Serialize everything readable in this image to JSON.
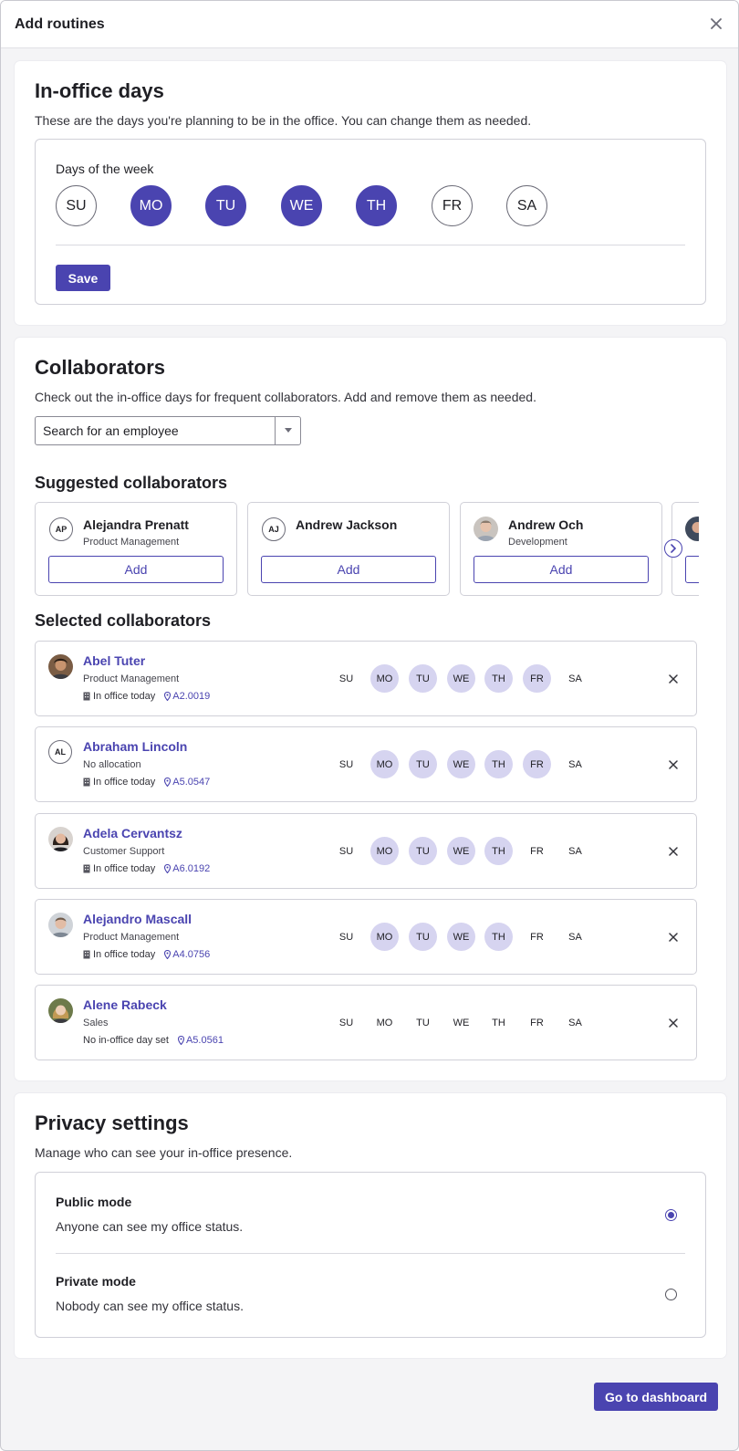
{
  "modal": {
    "title": "Add routines"
  },
  "in_office": {
    "title": "In-office days",
    "description": "These are the days you're planning to be in the office. You can change them as needed.",
    "days_label": "Days of the week",
    "days": [
      {
        "label": "SU",
        "selected": false
      },
      {
        "label": "MO",
        "selected": true
      },
      {
        "label": "TU",
        "selected": true
      },
      {
        "label": "WE",
        "selected": true
      },
      {
        "label": "TH",
        "selected": true
      },
      {
        "label": "FR",
        "selected": false
      },
      {
        "label": "SA",
        "selected": false
      }
    ],
    "save_label": "Save"
  },
  "collaborators": {
    "title": "Collaborators",
    "description": "Check out the in-office days for frequent collaborators. Add and remove them as needed.",
    "search_placeholder": "Search for an employee",
    "suggested_title": "Suggested collaborators",
    "suggested": [
      {
        "name": "Alejandra Prenatt",
        "dept": "Product Management",
        "initials": "AP",
        "add_label": "Add"
      },
      {
        "name": "Andrew Jackson",
        "dept": "",
        "initials": "AJ",
        "add_label": "Add"
      },
      {
        "name": "Andrew Och",
        "dept": "Development",
        "initials": "",
        "add_label": "Add"
      }
    ],
    "selected_title": "Selected collaborators",
    "selected": [
      {
        "name": "Abel Tuter",
        "dept": "Product Management",
        "status": "In office today",
        "location": "A2.0019",
        "days": [
          "SU",
          "MO",
          "TU",
          "WE",
          "TH",
          "FR",
          "SA"
        ],
        "on": [
          false,
          true,
          true,
          true,
          true,
          true,
          false
        ]
      },
      {
        "name": "Abraham Lincoln",
        "dept": "No allocation",
        "initials": "AL",
        "status": "In office today",
        "location": "A5.0547",
        "days": [
          "SU",
          "MO",
          "TU",
          "WE",
          "TH",
          "FR",
          "SA"
        ],
        "on": [
          false,
          true,
          true,
          true,
          true,
          true,
          false
        ]
      },
      {
        "name": "Adela Cervantsz",
        "dept": "Customer Support",
        "status": "In office today",
        "location": "A6.0192",
        "days": [
          "SU",
          "MO",
          "TU",
          "WE",
          "TH",
          "FR",
          "SA"
        ],
        "on": [
          false,
          true,
          true,
          true,
          true,
          false,
          false
        ]
      },
      {
        "name": "Alejandro Mascall",
        "dept": "Product Management",
        "status": "In office today",
        "location": "A4.0756",
        "days": [
          "SU",
          "MO",
          "TU",
          "WE",
          "TH",
          "FR",
          "SA"
        ],
        "on": [
          false,
          true,
          true,
          true,
          true,
          false,
          false
        ]
      },
      {
        "name": "Alene Rabeck",
        "dept": "Sales",
        "status": "No in-office day set",
        "location": "A5.0561",
        "days": [
          "SU",
          "MO",
          "TU",
          "WE",
          "TH",
          "FR",
          "SA"
        ],
        "on": [
          false,
          false,
          false,
          false,
          false,
          false,
          false
        ]
      }
    ]
  },
  "privacy": {
    "title": "Privacy settings",
    "description": "Manage who can see your in-office presence.",
    "options": [
      {
        "title": "Public mode",
        "desc": "Anyone can see my office status.",
        "checked": true
      },
      {
        "title": "Private mode",
        "desc": "Nobody can see my office status.",
        "checked": false
      }
    ]
  },
  "footer": {
    "dashboard_label": "Go to dashboard"
  },
  "colors": {
    "accent": "#4a44b0",
    "accent_soft": "#d6d4f0"
  }
}
